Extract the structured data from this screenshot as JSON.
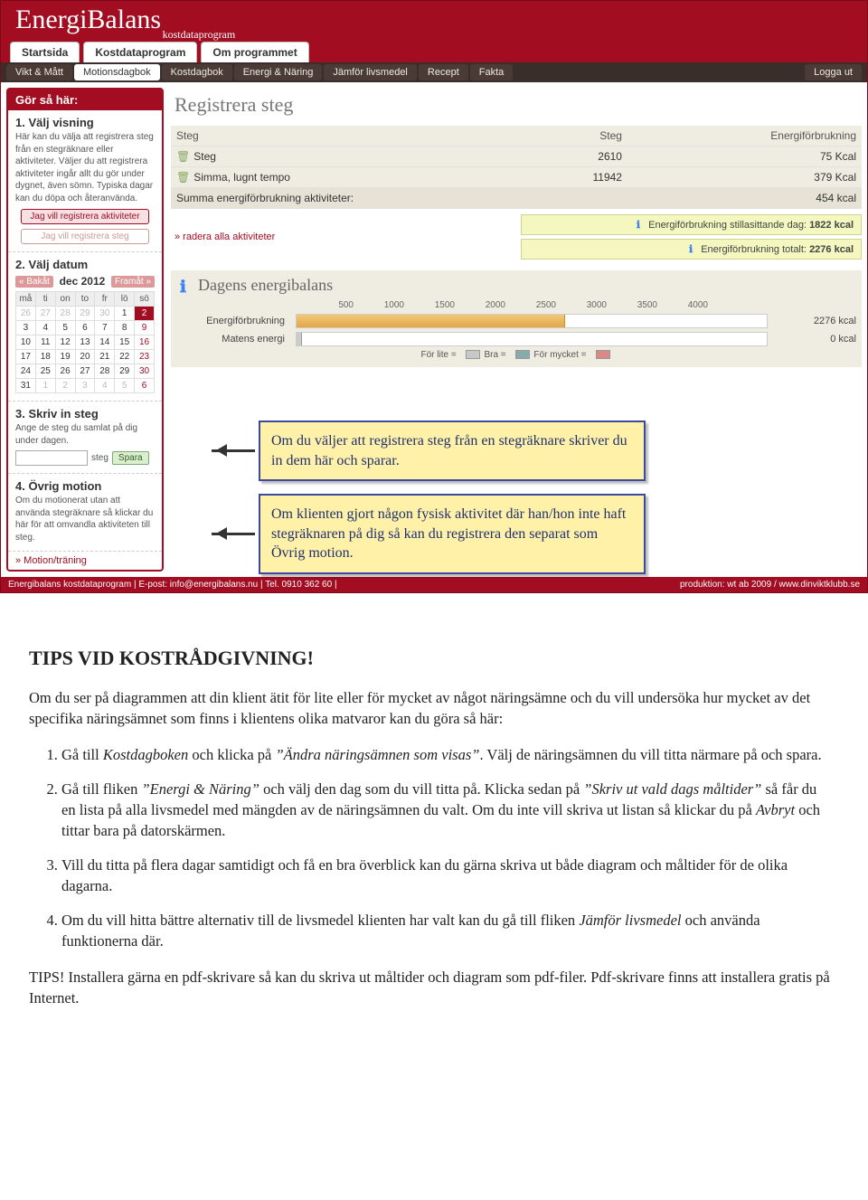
{
  "brand": {
    "name": "EnergiBalans",
    "sub": "kostdataprogram"
  },
  "top_tabs": {
    "t1": "Startsida",
    "t2": "Kostdataprogram",
    "t3": "Om programmet"
  },
  "subtabs": {
    "s1": "Vikt & Mått",
    "s2": "Motionsdagbok",
    "s3": "Kostdagbok",
    "s4": "Energi & Näring",
    "s5": "Jämför livsmedel",
    "s6": "Recept",
    "s7": "Fakta",
    "logout": "Logga ut"
  },
  "sidebar": {
    "title": "Gör så här:",
    "sec1": {
      "h": "1. Välj visning",
      "desc": "Här kan du välja att registrera steg från en stegräknare eller aktiviteter. Väljer du att registrera aktiviteter ingår allt du gör under dygnet, även sömn. Typiska dagar kan du döpa och återanvända.",
      "btn1": "Jag vill registrera aktiviteter",
      "btn2": "Jag vill registrera steg"
    },
    "sec2": {
      "h": "2. Välj datum",
      "back": "« Bakåt",
      "month": "dec 2012",
      "fwd": "Framåt »",
      "dow": {
        "d1": "må",
        "d2": "ti",
        "d3": "on",
        "d4": "to",
        "d5": "fr",
        "d6": "lö",
        "d7": "sö"
      },
      "w1": {
        "c1": "26",
        "c2": "27",
        "c3": "28",
        "c4": "29",
        "c5": "30",
        "c6": "1",
        "c7": "2"
      },
      "w2": {
        "c1": "3",
        "c2": "4",
        "c3": "5",
        "c4": "6",
        "c5": "7",
        "c6": "8",
        "c7": "9"
      },
      "w3": {
        "c1": "10",
        "c2": "11",
        "c3": "12",
        "c4": "13",
        "c5": "14",
        "c6": "15",
        "c7": "16"
      },
      "w4": {
        "c1": "17",
        "c2": "18",
        "c3": "19",
        "c4": "20",
        "c5": "21",
        "c6": "22",
        "c7": "23"
      },
      "w5": {
        "c1": "24",
        "c2": "25",
        "c3": "26",
        "c4": "27",
        "c5": "28",
        "c6": "29",
        "c7": "30"
      },
      "w6": {
        "c1": "31",
        "c2": "1",
        "c3": "2",
        "c4": "3",
        "c5": "4",
        "c6": "5",
        "c7": "6"
      }
    },
    "sec3": {
      "h": "3. Skriv in steg",
      "desc": "Ange de steg du samlat på dig under dagen.",
      "unit": "steg",
      "save": "Spara"
    },
    "sec4": {
      "h": "4. Övrig motion",
      "desc": "Om du motionerat utan att använda stegräknare så klickar du här för att omvandla aktiviteten till steg."
    },
    "link": "» Motion/träning"
  },
  "main": {
    "title": "Registrera steg",
    "th1": "Steg",
    "th2": "Steg",
    "th3": "Energiförbrukning",
    "r1": {
      "name": "Steg",
      "steps": "2610",
      "kcal": "75 Kcal"
    },
    "r2": {
      "name": "Simma, lugnt tempo",
      "steps": "11942",
      "kcal": "379 Kcal"
    },
    "sum": {
      "label": "Summa energiförbrukning aktiviteter:",
      "kcal": "454 kcal"
    },
    "dellink": "» radera alla aktiviteter",
    "still": {
      "label": "Energiförbrukning stillasittande dag:",
      "val": "1822 kcal"
    },
    "total": {
      "label": "Energiförbrukning totalt:",
      "val": "2276 kcal"
    },
    "chart": {
      "title": "Dagens energibalans",
      "ticks": {
        "t1": "500",
        "t2": "1000",
        "t3": "1500",
        "t4": "2000",
        "t5": "2500",
        "t6": "3000",
        "t7": "3500",
        "t8": "4000"
      },
      "row1": {
        "label": "Energiförbrukning",
        "val": "2276 kcal"
      },
      "row2": {
        "label": "Matens energi",
        "val": "0 kcal"
      },
      "legend": {
        "l1": "För lite =",
        "l2": "Bra =",
        "l3": "För mycket ="
      }
    }
  },
  "footer": {
    "left": "Energibalans kostdataprogram | E-post: info@energibalans.nu | Tel. 0910 362 60 |",
    "right": "produktion: wt ab 2009 / www.dinviktklubb.se"
  },
  "callouts": {
    "c1": "Om du väljer att registrera steg från en stegräknare skriver du in dem här och sparar.",
    "c2": "Om klienten gjort någon fysisk aktivitet där han/hon inte haft stegräknaren på dig så kan du registrera den separat som Övrig motion."
  },
  "article": {
    "h": "TIPS VID KOSTRÅDGIVNING!",
    "intro": "Om du ser på diagrammen att din klient ätit för lite eller för mycket av något näringsämne och du vill undersöka hur mycket av det specifika näringsämnet som finns i klientens olika matvaror kan du göra så här:",
    "li1a": "Gå till ",
    "li1b": "Kostdagboken",
    "li1c": " och klicka på ",
    "li1d": "”Ändra näringsämnen som visas”",
    "li1e": ". Välj de näringsämnen du vill titta närmare på och spara.",
    "li2a": "Gå till fliken ",
    "li2b": "”Energi & Näring”",
    "li2c": " och välj den dag som du vill titta på. Klicka sedan på ",
    "li2d": "”Skriv ut vald dags måltider”",
    "li2e": " så får du en lista på alla livsmedel med mängden av de näringsämnen du valt. Om du inte vill skriva ut listan så klickar du på ",
    "li2f": "Avbryt",
    "li2g": " och tittar bara på datorskärmen.",
    "li3": "Vill du titta på flera dagar samtidigt och få en bra överblick kan du gärna skriva ut både diagram och måltider för de olika dagarna.",
    "li4a": "Om du vill hitta bättre alternativ till de livsmedel klienten har valt kan du gå till fliken ",
    "li4b": "Jämför livsmedel",
    "li4c": " och använda funktionerna där.",
    "tip": "TIPS! Installera gärna en pdf-skrivare så kan du skriva ut måltider och diagram som pdf-filer. Pdf-skrivare finns att installera gratis på Internet."
  },
  "chart_data": {
    "type": "bar",
    "title": "Dagens energibalans",
    "xlabel": "",
    "ylabel": "kcal",
    "orientation": "horizontal",
    "xlim": [
      0,
      4000
    ],
    "ticks": [
      500,
      1000,
      1500,
      2000,
      2500,
      3000,
      3500,
      4000
    ],
    "categories": [
      "Energiförbrukning",
      "Matens energi"
    ],
    "values": [
      2276,
      0
    ],
    "legend": [
      "För lite",
      "Bra",
      "För mycket"
    ]
  }
}
